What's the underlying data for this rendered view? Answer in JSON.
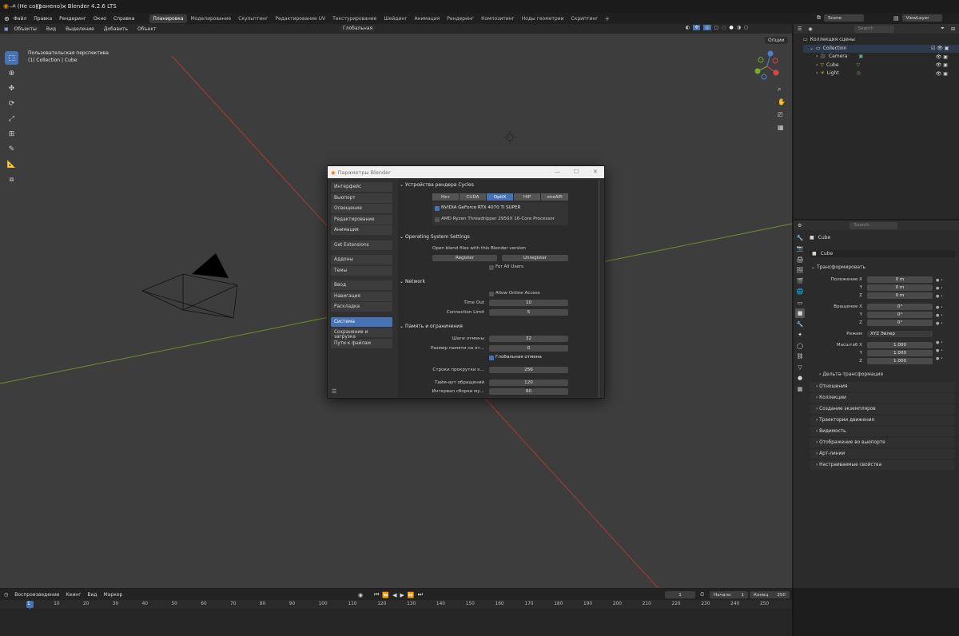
{
  "window": {
    "title": "* (Не сохранено) - Blender 4.2.6 LTS"
  },
  "menu": [
    "Файл",
    "Правка",
    "Рендеринг",
    "Окно",
    "Справка"
  ],
  "workspaces": [
    "Планировка",
    "Моделирование",
    "Скульптинг",
    "Редактирование UV",
    "Текстурирование",
    "Шейдинг",
    "Анимация",
    "Рендеринг",
    "Композитинг",
    "Ноды геометрии",
    "Скриптинг"
  ],
  "scene": {
    "name": "Scene",
    "view_layer": "ViewLayer",
    "search_placeholder": "Search"
  },
  "viewport": {
    "mode": "Объекты",
    "menus": [
      "Вид",
      "Выделение",
      "Добавить",
      "Объект"
    ],
    "orientation": "Глобальная",
    "options": "Опции",
    "overlay_line1": "Пользовательская перспектива",
    "overlay_line2": "(1) Collection | Cube"
  },
  "prefs": {
    "title": "Параметры Blender",
    "sidebar": [
      "Интерфейс",
      "Вьюпорт",
      "Освещение",
      "Редактирование",
      "Анимация",
      "Get Extensions",
      "Аддоны",
      "Темы",
      "Ввод",
      "Навигация",
      "Раскладка",
      "Система",
      "Сохранение и загрузка",
      "Пути к файлам"
    ],
    "cycles": {
      "header": "Устройства рендера Cycles",
      "tabs": [
        "Нет",
        "CUDA",
        "OptiX",
        "HIP",
        "oneAPI"
      ],
      "active_tab": "OptiX",
      "devices": [
        {
          "name": "NVIDIA GeForce RTX 4070 Ti SUPER",
          "checked": true
        },
        {
          "name": "AMD Ryzen Threadripper 2950X 16-Core Processor",
          "checked": false
        }
      ]
    },
    "os": {
      "header": "Operating System Settings",
      "text": "Open blend files with this Blender version",
      "register": "Register",
      "unregister": "Unregister",
      "for_all": "For All Users"
    },
    "network": {
      "header": "Network",
      "online": "Allow Online Access",
      "timeout_label": "Time Out",
      "timeout": "10",
      "conn_label": "Connection Limit",
      "conn": "5"
    },
    "memory": {
      "header": "Память и ограничения",
      "undo_label": "Шаги отмены",
      "undo": "32",
      "mem_label": "Размер памяти на от...",
      "mem": "0",
      "global_undo": "Глобальная отмена",
      "scroll_label": "Строки прокрутки к...",
      "scroll": "256",
      "timeout_label": "Тайм-аут обращений",
      "timeout": "120",
      "gc_label": "Интервал сборки му...",
      "gc": "60"
    }
  },
  "outliner": {
    "title": "Коллекция сцены",
    "collection": "Collection",
    "items": [
      "Camera",
      "Cube",
      "Light"
    ]
  },
  "properties": {
    "search_placeholder": "Search",
    "object": "Cube",
    "object_field": "Cube",
    "transform": "Трансформировать",
    "loc_label": "Положение X",
    "rot_label": "Вращение X",
    "scale_label": "Масштаб X",
    "y": "Y",
    "z": "Z",
    "loc": [
      "0 m",
      "0 m",
      "0 m"
    ],
    "rot": [
      "0°",
      "0°",
      "0°"
    ],
    "mode_label": "Режим",
    "mode": "XYZ Эйлер",
    "scale": [
      "1.000",
      "1.000",
      "1.000"
    ],
    "delta": "Дельта-трансформация",
    "panels": [
      "Отношения",
      "Коллекции",
      "Создание экземпляров",
      "Траектории движения",
      "Видимость",
      "Отображение во вьюпорте",
      "Арт-линии",
      "Настраиваемые свойства"
    ]
  },
  "timeline": {
    "menus": [
      "Воспроизведение",
      "Кеинг",
      "Вид",
      "Маркер"
    ],
    "current": "1",
    "start_label": "Начало",
    "start": "1",
    "end_label": "Конец",
    "end": "250",
    "ticks": [
      "1",
      "10",
      "20",
      "30",
      "40",
      "50",
      "60",
      "70",
      "80",
      "90",
      "100",
      "110",
      "120",
      "130",
      "140",
      "150",
      "160",
      "170",
      "180",
      "190",
      "200",
      "210",
      "220",
      "230",
      "240",
      "250"
    ]
  },
  "colors": {
    "accent": "#4772b3",
    "x_axis": "#a83a3a",
    "y_axis": "#6f8f2a"
  }
}
